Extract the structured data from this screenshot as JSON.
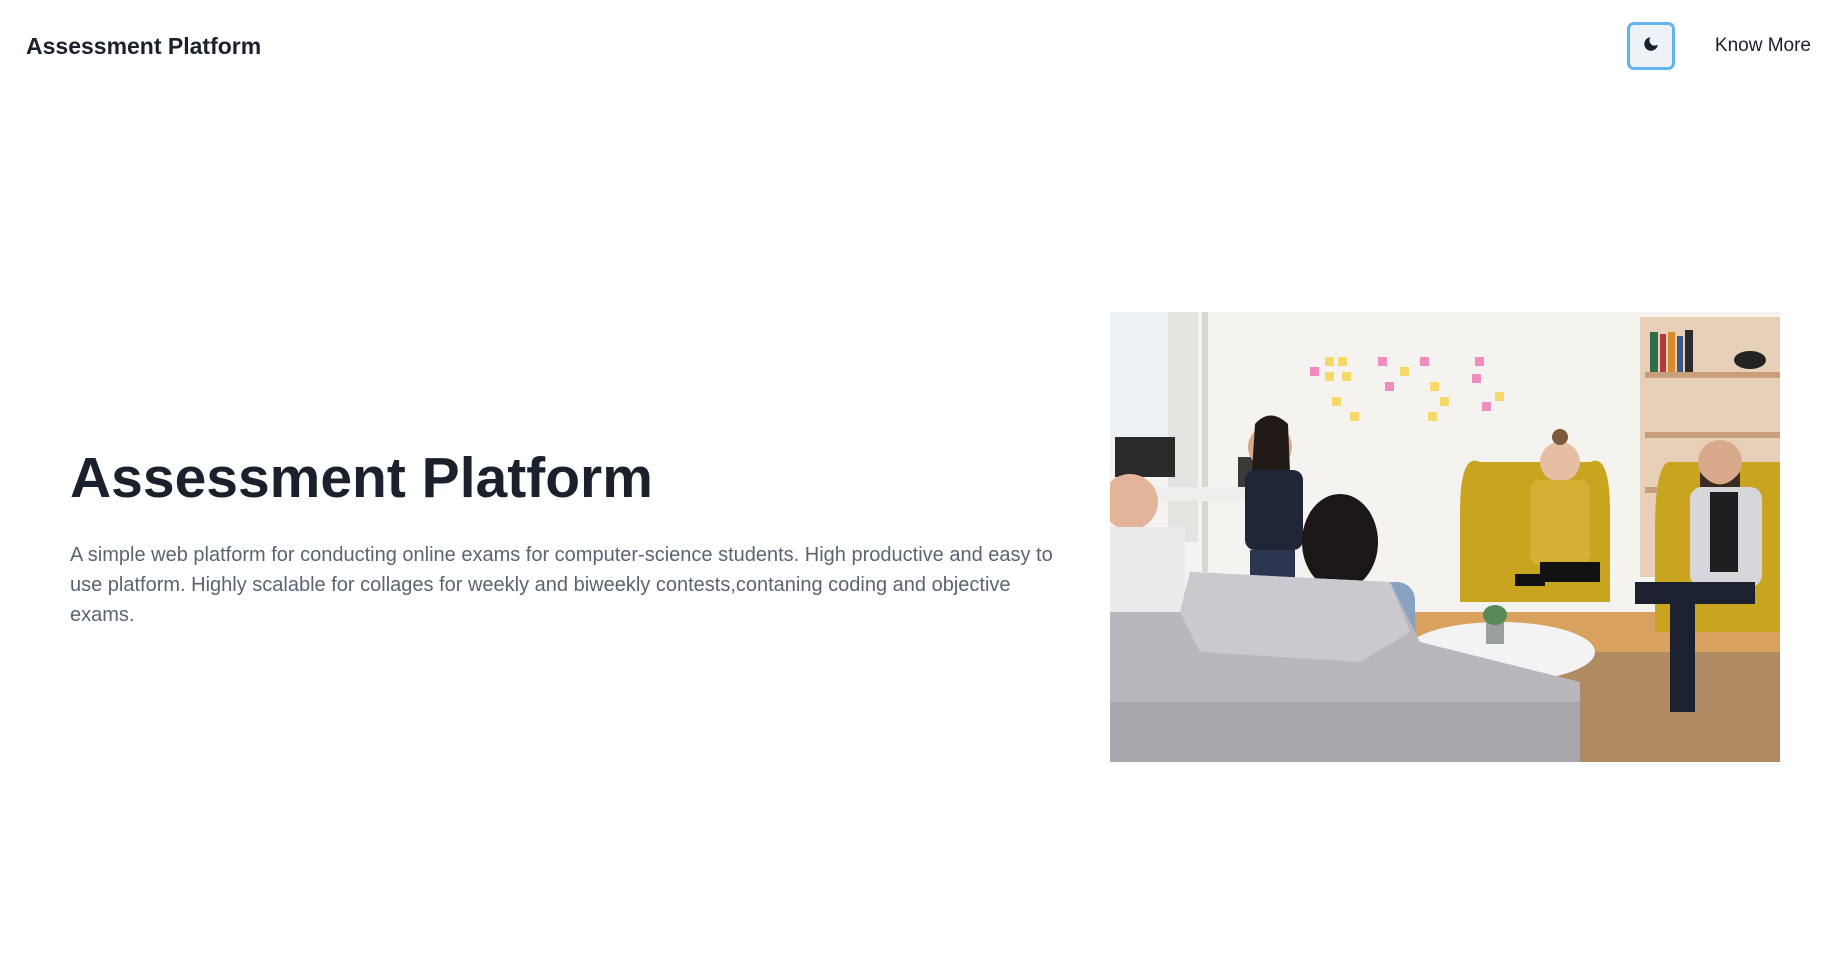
{
  "header": {
    "brand": "Assessment Platform",
    "theme_toggle_icon": "moon-icon",
    "know_more_label": "Know More"
  },
  "hero": {
    "title": "Assessment Platform",
    "description": "A simple web platform for conducting online exams for computer-science students. High productive and easy to use platform. Highly scalable for collages for weekly and biweekly contests,contaning coding and objective exams.",
    "image_alt": "Group of people sitting in a bright office lounge having a discussion"
  },
  "colors": {
    "text_primary": "#1a202c",
    "text_secondary": "#5a6472",
    "toggle_border": "#63b3ed",
    "toggle_bg": "#edf2f7"
  }
}
